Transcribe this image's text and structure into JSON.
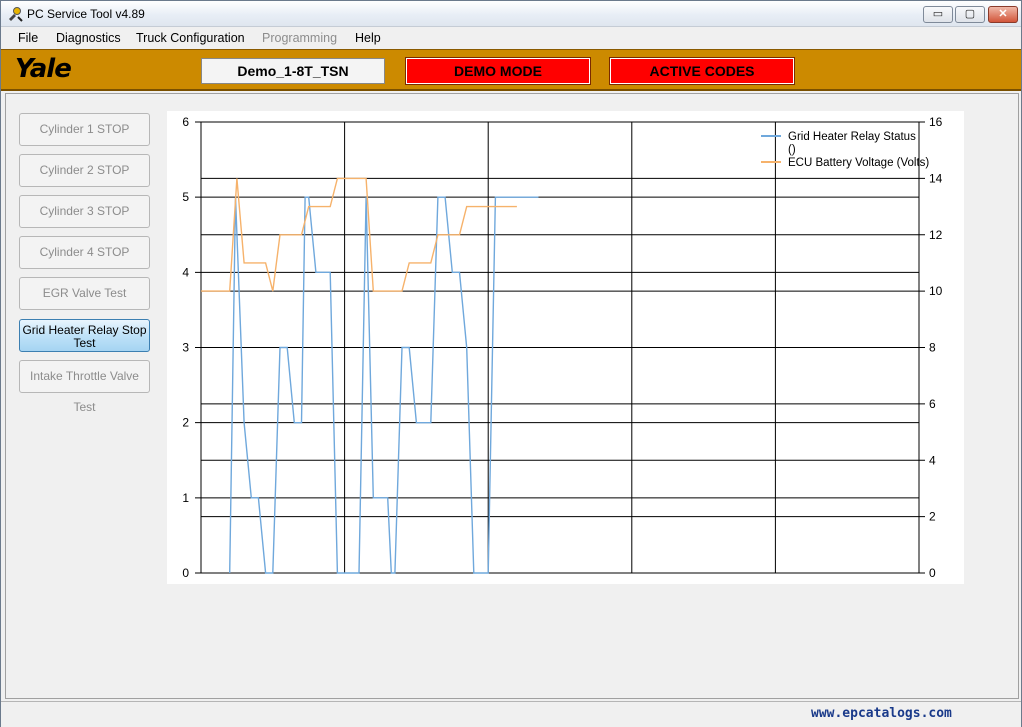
{
  "window": {
    "title": "PC Service Tool v4.89",
    "controls": {
      "minimize": "▭",
      "maximize": "▢",
      "close": "✕"
    }
  },
  "menu": {
    "items": [
      {
        "label": "File",
        "enabled": true
      },
      {
        "label": "Diagnostics",
        "enabled": true
      },
      {
        "label": "Truck Configuration",
        "enabled": true
      },
      {
        "label": "Programming",
        "enabled": false
      },
      {
        "label": "Help",
        "enabled": true
      }
    ]
  },
  "header": {
    "logo_text": "Yale",
    "truck_id": "Demo_1-8T_TSN",
    "demo_mode": "DEMO MODE",
    "active_codes": "ACTIVE CODES"
  },
  "tests": {
    "buttons": [
      {
        "label": "Cylinder 1 STOP",
        "active": false
      },
      {
        "label": "Cylinder 2 STOP",
        "active": false
      },
      {
        "label": "Cylinder 3 STOP",
        "active": false
      },
      {
        "label": "Cylinder 4 STOP",
        "active": false
      },
      {
        "label": "EGR Valve Test",
        "active": false
      },
      {
        "label": "Grid Heater Relay Stop Test",
        "active": true
      },
      {
        "label": "Intake Throttle Valve Test",
        "active": false
      }
    ]
  },
  "chart_data": {
    "type": "line",
    "title": "",
    "xlabel": "",
    "ylabel": "",
    "y_left": {
      "range": [
        0,
        6
      ],
      "ticks": [
        "0",
        "1",
        "2",
        "3",
        "4",
        "5",
        "6"
      ]
    },
    "y_right": {
      "range": [
        0,
        16
      ],
      "ticks": [
        "0",
        "2",
        "4",
        "6",
        "8",
        "10",
        "12",
        "14",
        "16"
      ]
    },
    "x_range": [
      0,
      100
    ],
    "x_gridlines": [
      0,
      20,
      40,
      60,
      80,
      100
    ],
    "grid": true,
    "legend_position": "top-right",
    "series": [
      {
        "name": "Grid Heater Relay Status ()",
        "axis": "left",
        "color": "#6fa8dc",
        "x": [
          4,
          4.8,
          6,
          7,
          8,
          9,
          9.5,
          10,
          11,
          11.5,
          12,
          13,
          14,
          14.5,
          15,
          16,
          17,
          18,
          19,
          20,
          21,
          22,
          23,
          24,
          25,
          26,
          26.5,
          27,
          28,
          29,
          30,
          31,
          32,
          33,
          34,
          35,
          36,
          37,
          38,
          38.5,
          39,
          40,
          41,
          42,
          43,
          44,
          45,
          46,
          47
        ],
        "y": [
          0,
          5,
          2,
          1,
          1,
          0,
          0,
          0,
          3,
          3,
          3,
          2,
          2,
          5,
          5,
          4,
          4,
          4,
          0,
          0,
          0,
          0,
          5,
          1,
          1,
          1,
          0,
          0,
          3,
          3,
          2,
          2,
          2,
          5,
          5,
          4,
          4,
          3,
          0,
          0,
          0,
          0,
          5,
          5,
          5,
          5,
          5,
          5,
          5
        ]
      },
      {
        "name": "ECU Battery Voltage (Volts)",
        "axis": "right",
        "color": "#f6b26b",
        "x": [
          0,
          4,
          5,
          6,
          7,
          8,
          9,
          10,
          11,
          12,
          13,
          14,
          15,
          16,
          17,
          18,
          19,
          20,
          21,
          22,
          23,
          24,
          25,
          26,
          27,
          28,
          29,
          30,
          31,
          32,
          33,
          34,
          35,
          36,
          37,
          38,
          39,
          40,
          41,
          42,
          43,
          44
        ],
        "y": [
          10,
          10,
          14,
          11,
          11,
          11,
          11,
          10,
          12,
          12,
          12,
          12,
          13,
          13,
          13,
          13,
          14,
          14,
          14,
          14,
          14,
          10,
          10,
          10,
          10,
          10,
          11,
          11,
          11,
          11,
          12,
          12,
          12,
          12,
          13,
          13,
          13,
          13,
          13,
          13,
          13,
          13
        ]
      }
    ]
  },
  "statusbar": {
    "watermark": "www.epcatalogs.com"
  }
}
